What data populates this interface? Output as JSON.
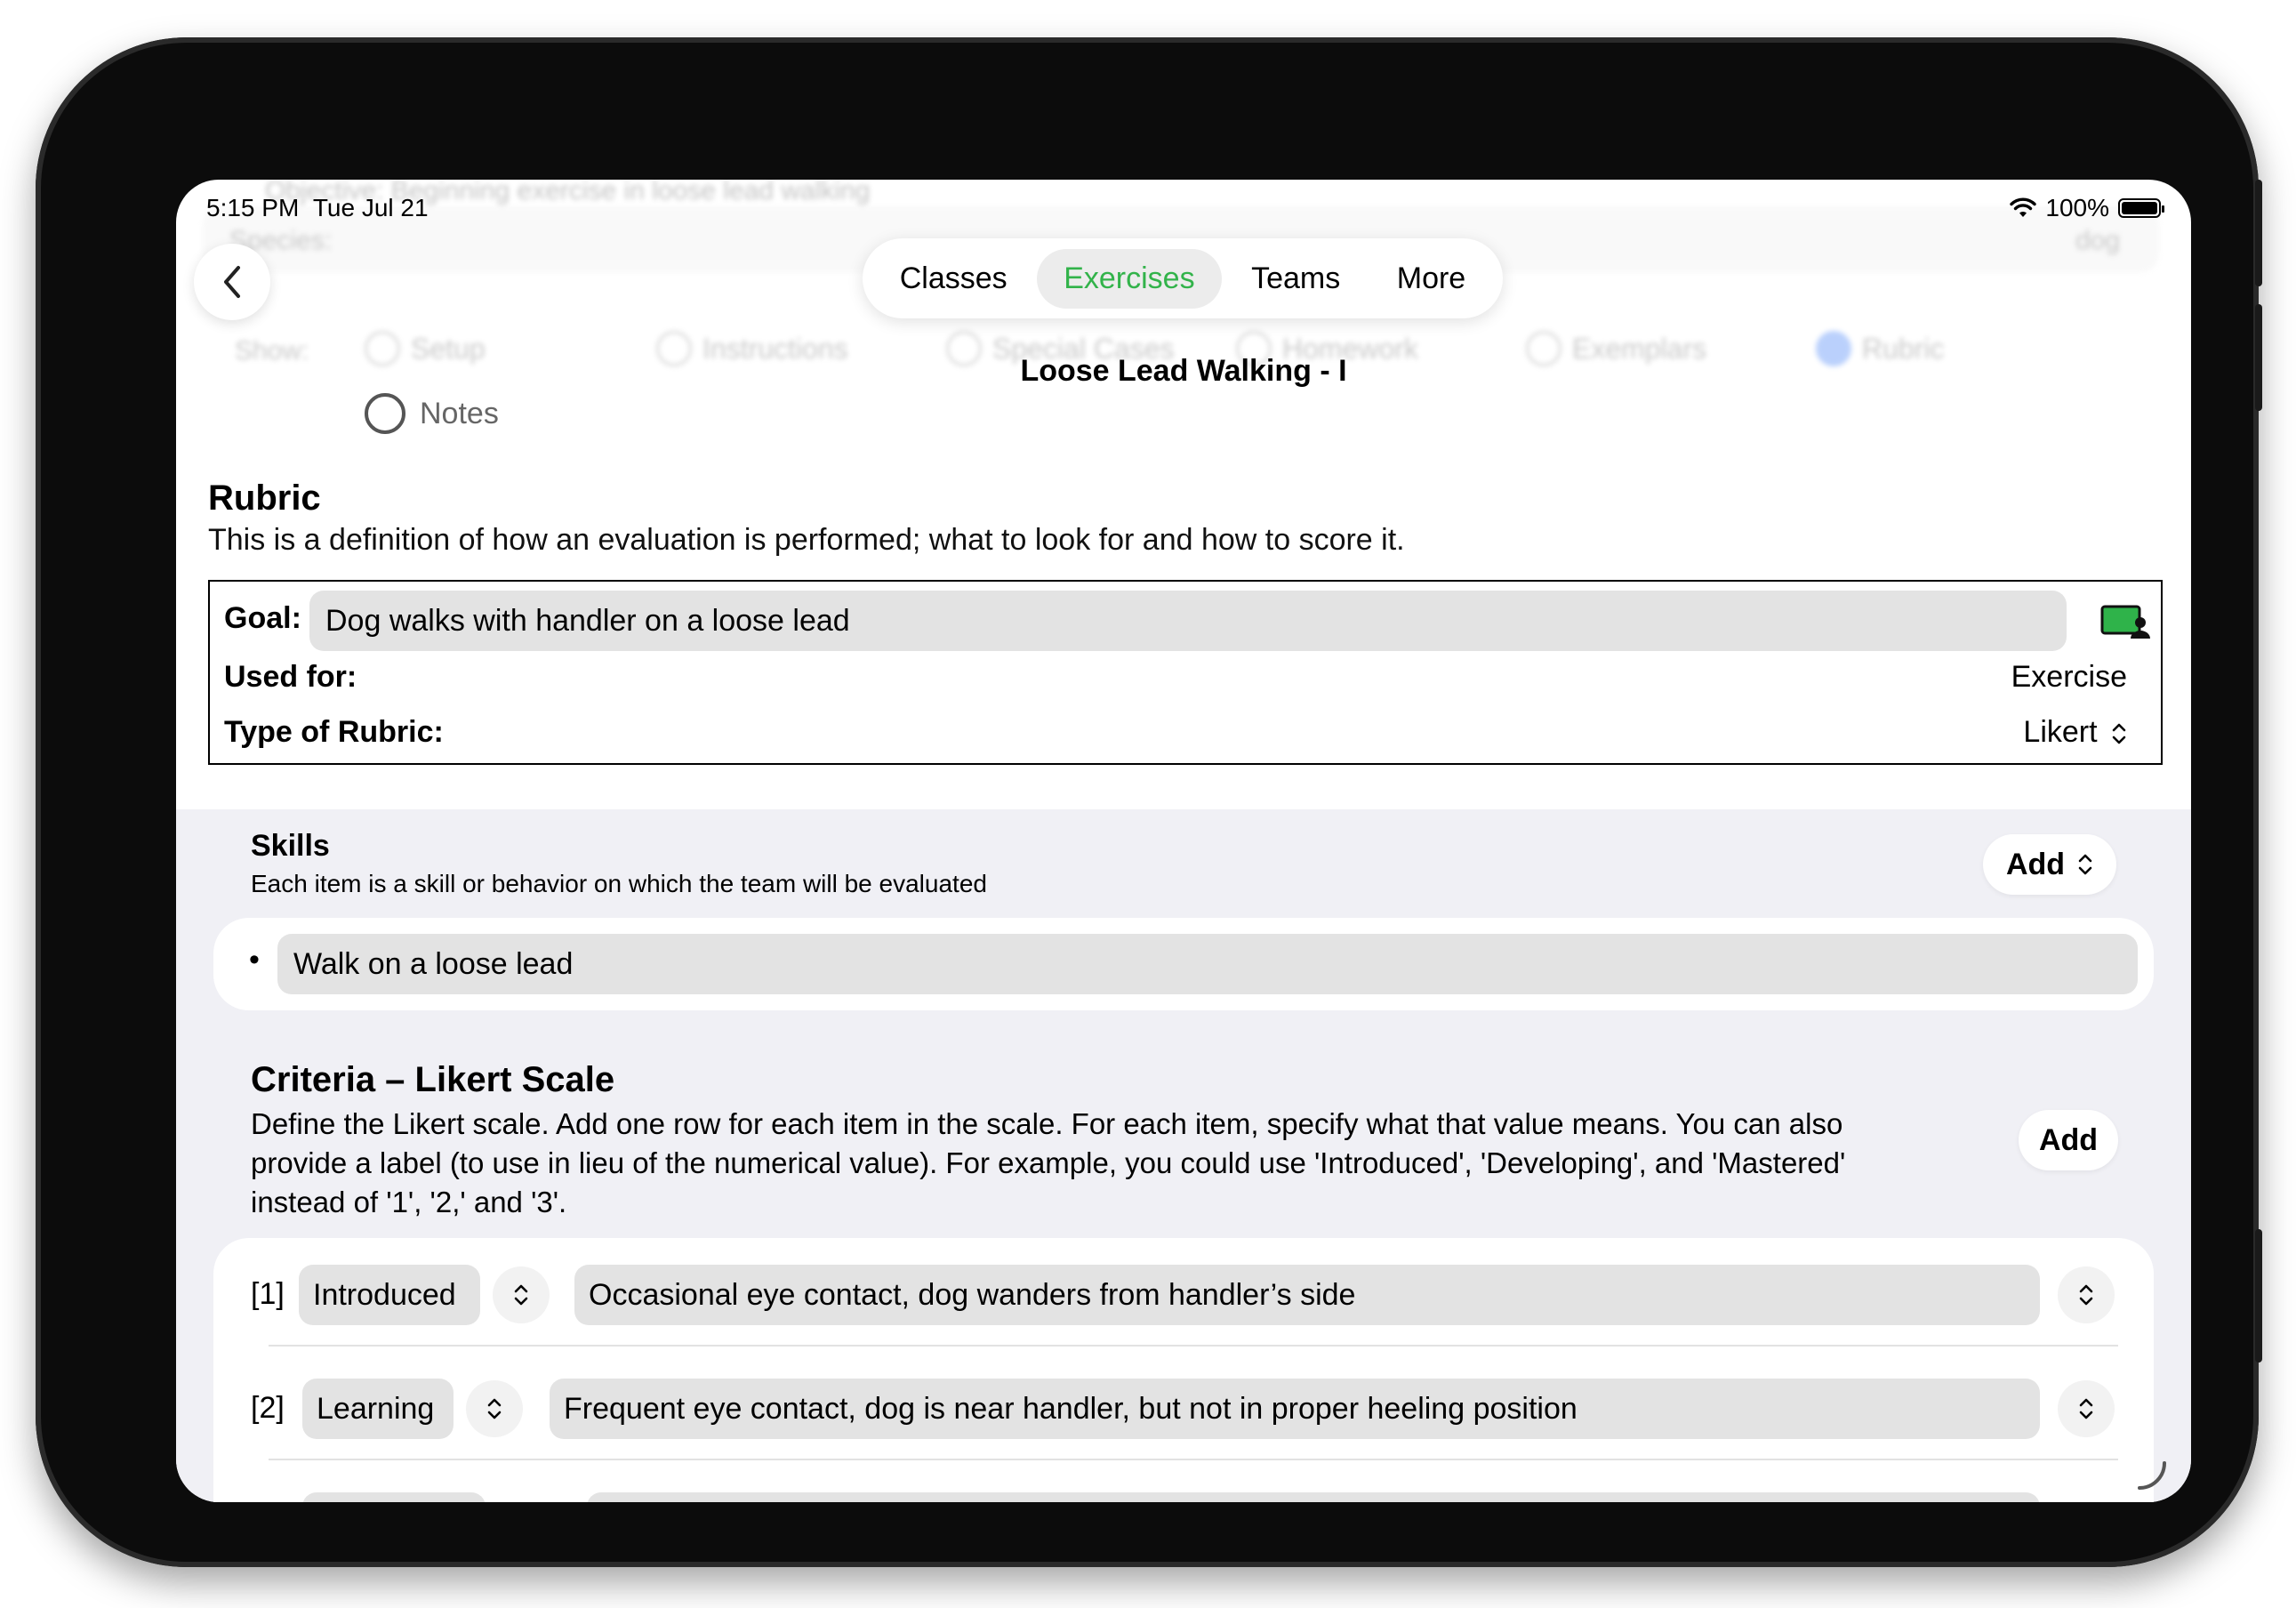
{
  "status": {
    "time": "5:15 PM",
    "date": "Tue Jul 21",
    "battery": "100%"
  },
  "background": {
    "line": "Objective: Beginning exercise in loose lead walking",
    "species_label": "Species:",
    "species_value": "dog",
    "show_label": "Show:",
    "radios": [
      "Setup",
      "Instructions",
      "Special Cases",
      "Homework",
      "Exemplars",
      "Rubric"
    ],
    "notes": "Notes"
  },
  "tabs": [
    "Classes",
    "Exercises",
    "Teams",
    "More"
  ],
  "active_tab": "Exercises",
  "page_title": "Loose Lead Walking - I",
  "rubric": {
    "title": "Rubric",
    "description": "This is a definition of how an evaluation is performed; what to look for and how to score it.",
    "goal_label": "Goal:",
    "goal_value": "Dog walks with handler on a loose lead",
    "used_for_label": "Used for:",
    "used_for_value": "Exercise",
    "type_label": "Type of Rubric:",
    "type_value": "Likert"
  },
  "skills": {
    "title": "Skills",
    "description": "Each item is a skill or behavior on which the team will be evaluated",
    "add_label": "Add",
    "bullet": "•",
    "items": [
      "Walk on a loose lead"
    ]
  },
  "criteria": {
    "title": "Criteria – Likert Scale",
    "description": "Define the Likert scale. Add one row for each item in the scale. For each item, specify what that value means. You can also provide a label (to use in lieu of the numerical value). For example, you could use 'Introduced', 'Developing', and 'Mastered' instead of '1', '2,' and '3'.",
    "add_label": "Add",
    "rows": [
      {
        "num": "[1]",
        "label": "Introduced",
        "desc": "Occasional eye contact, dog wanders from handler’s side"
      },
      {
        "num": "[2]",
        "label": "Learning",
        "desc": "Frequent eye contact, dog is near handler, but not in proper heeling position"
      }
    ]
  },
  "colors": {
    "accent": "#32b34a",
    "field": "#e3e3e3",
    "group_bg": "#f0f0f5"
  }
}
